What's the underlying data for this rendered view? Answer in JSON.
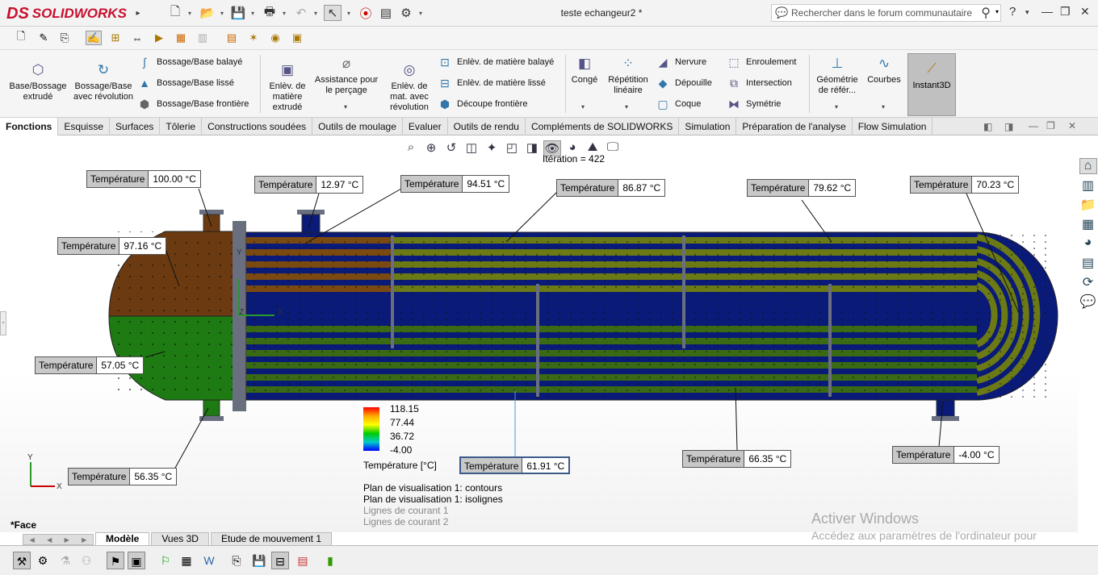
{
  "app": {
    "logo_text": "SOLIDWORKS",
    "logo_mark": "DS",
    "document_title": "teste echangeur2 *"
  },
  "search": {
    "placeholder": "Rechercher dans le forum communautaire"
  },
  "ribbon": {
    "base_bossage_extrude": "Base/Bossage extrudé",
    "base_bossage_revolution": "Bossage/Base avec révolution",
    "bossage_balaye": "Bossage/Base balayé",
    "bossage_lisse": "Bossage/Base lissé",
    "bossage_frontiere": "Bossage/Base frontière",
    "enlev_extrude": "Enlèv. de matière extrudé",
    "assistance_percage": "Assistance pour le perçage",
    "enlev_revolution": "Enlèv. de mat. avec révolution",
    "enlev_balaye": "Enlèv. de matière balayé",
    "enlev_lisse": "Enlèv. de matière lissé",
    "decoupe_frontiere": "Découpe frontière",
    "conge": "Congé",
    "repetition_lineaire": "Répétition linéaire",
    "nervure": "Nervure",
    "depouille": "Dépouille",
    "coque": "Coque",
    "enroulement": "Enroulement",
    "intersection": "Intersection",
    "symetrie": "Symétrie",
    "geometrie_reference": "Géométrie de référ...",
    "courbes": "Courbes",
    "instant3d": "Instant3D"
  },
  "tabs": [
    "Fonctions",
    "Esquisse",
    "Surfaces",
    "Tôlerie",
    "Constructions soudées",
    "Outils de moulage",
    "Evaluer",
    "Outils de rendu",
    "Compléments de SOLIDWORKS",
    "Simulation",
    "Préparation de l'analyse",
    "Flow Simulation"
  ],
  "iteration": "Itération = 422",
  "probe_key": "Température",
  "probes": [
    {
      "value": "100.00 °C"
    },
    {
      "value": "12.97 °C"
    },
    {
      "value": "94.51 °C"
    },
    {
      "value": "86.87 °C"
    },
    {
      "value": "79.62 °C"
    },
    {
      "value": "70.23 °C"
    },
    {
      "value": "97.16 °C"
    },
    {
      "value": "57.05 °C"
    },
    {
      "value": "56.35 °C"
    },
    {
      "value": "61.91 °C"
    },
    {
      "value": "66.35 °C"
    },
    {
      "value": "-4.00 °C"
    }
  ],
  "legend": {
    "ticks": [
      "118.15",
      "77.44",
      "36.72",
      "-4.00"
    ],
    "title": "Température [°C]",
    "colors": [
      "#ff0000",
      "#ffaa00",
      "#ffff00",
      "#00cc00",
      "#00cccc",
      "#0000ff"
    ]
  },
  "planes": [
    "Plan de visualisation 1: contours",
    "Plan de visualisation 1: isolignes",
    "Lignes de courant 1",
    "Lignes de courant 2"
  ],
  "face_label": "*Face",
  "bottom_tabs": [
    "Modèle",
    "Vues 3D",
    "Etude de mouvement 1"
  ],
  "watermark": {
    "title": "Activer Windows",
    "text": "Accédez aux paramètres de l'ordinateur pour activer Windows."
  },
  "triad": {
    "x": "X",
    "y": "Y",
    "z": "Z"
  },
  "colors": {
    "hot": "#6b3a10",
    "mid": "#1e7a12",
    "olive": "#6b7a14",
    "cold": "#0a1a78",
    "accent": "#c8102e"
  }
}
